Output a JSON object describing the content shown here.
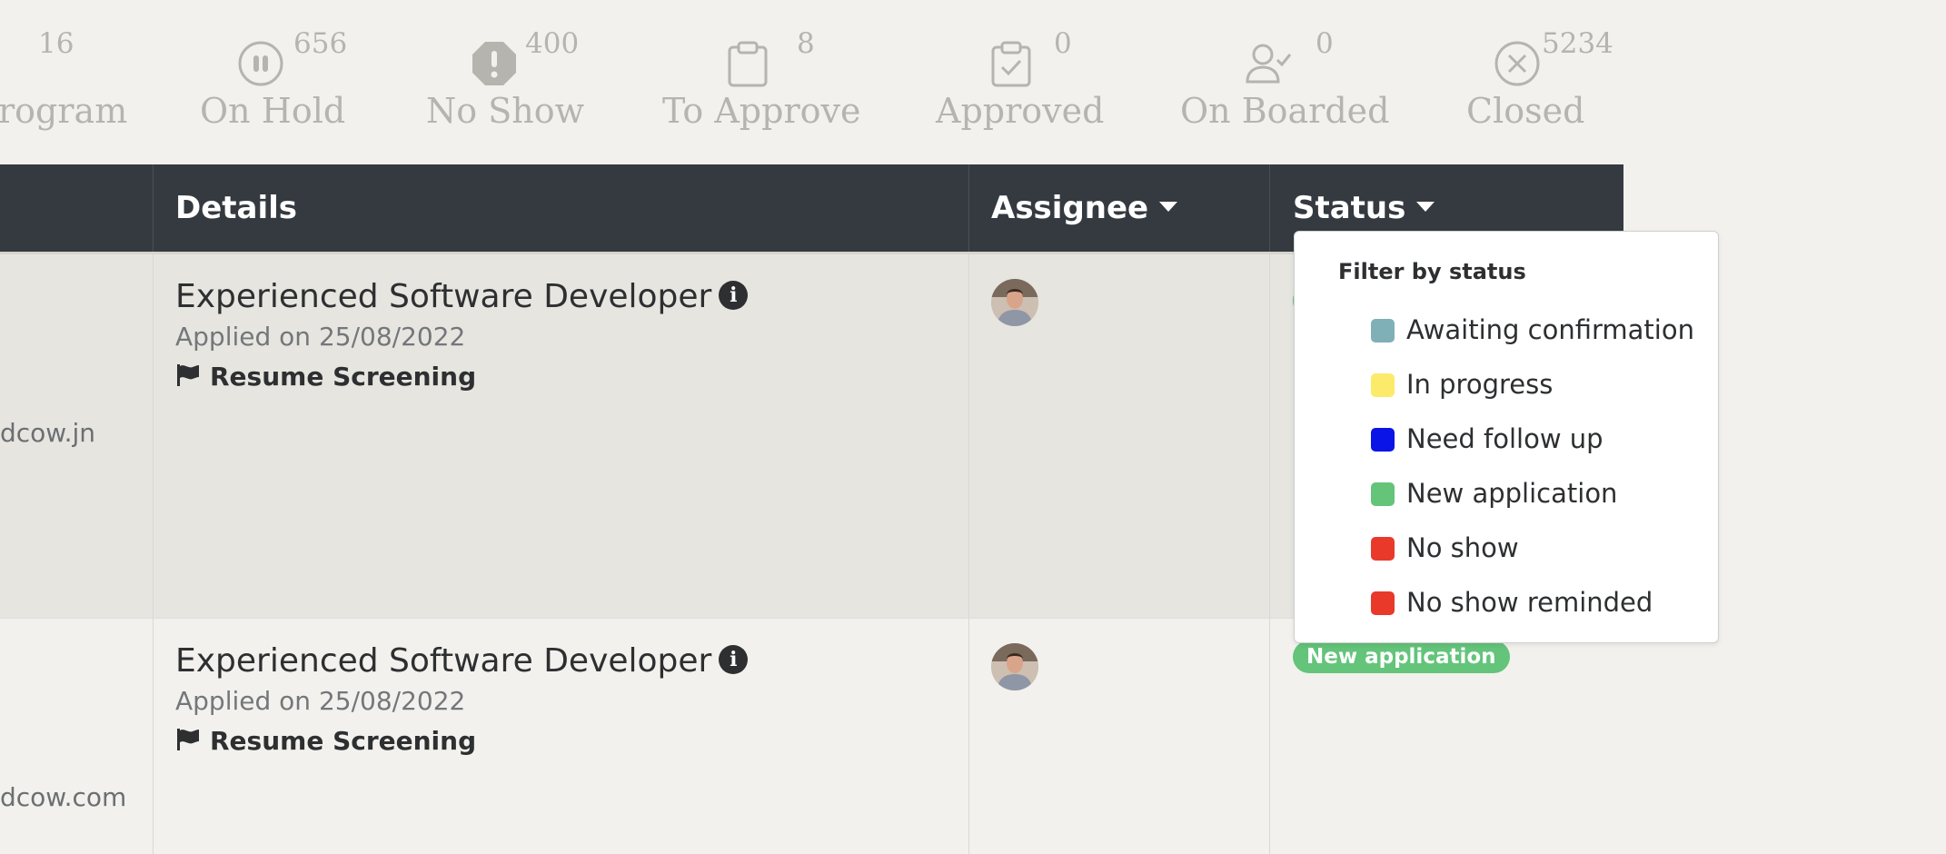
{
  "stats": [
    {
      "key": "program",
      "label": "rogram",
      "count": "16",
      "icon": "chevron-right-icon"
    },
    {
      "key": "on_hold",
      "label": "On Hold",
      "count": "656",
      "icon": "pause-circle-icon"
    },
    {
      "key": "no_show",
      "label": "No Show",
      "count": "400",
      "icon": "alert-octagon-icon"
    },
    {
      "key": "to_approve",
      "label": "To Approve",
      "count": "8",
      "icon": "clipboard-icon"
    },
    {
      "key": "approved",
      "label": "Approved",
      "count": "0",
      "icon": "clipboard-check-icon"
    },
    {
      "key": "on_boarded",
      "label": "On Boarded",
      "count": "0",
      "icon": "user-check-icon"
    },
    {
      "key": "closed",
      "label": "Closed",
      "count": "5234",
      "icon": "x-circle-icon"
    }
  ],
  "table": {
    "headers": {
      "details": "Details",
      "assignee": "Assignee",
      "status": "Status"
    },
    "rows": [
      {
        "email": "dcow.jn",
        "job_title": "Experienced Software Developer",
        "applied": "Applied on 25/08/2022",
        "stage": "Resume Screening",
        "status": ""
      },
      {
        "email": "dcow.com",
        "job_title": "Experienced Software Developer",
        "applied": "Applied on 25/08/2022",
        "stage": "Resume Screening",
        "status": "New application"
      }
    ]
  },
  "status_filter": {
    "title": "Filter by status",
    "options": [
      {
        "label": "Awaiting confirmation",
        "color": "#7fb0b7"
      },
      {
        "label": "In progress",
        "color": "#fcea6b"
      },
      {
        "label": "Need follow up",
        "color": "#0a14e6"
      },
      {
        "label": "New application",
        "color": "#63c47a"
      },
      {
        "label": "No show",
        "color": "#e8392b"
      },
      {
        "label": "No show reminded",
        "color": "#e8392b"
      }
    ]
  },
  "colors": {
    "header_bg": "#343a40",
    "badge_green": "#63c47a",
    "stat_gray": "#b6b4ae"
  }
}
